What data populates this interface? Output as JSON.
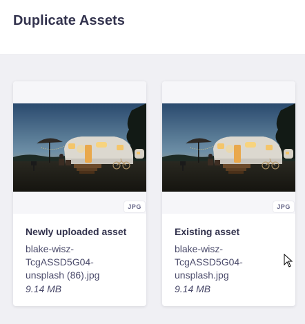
{
  "dialog": {
    "title": "Duplicate Assets"
  },
  "cards": [
    {
      "heading": "Newly uploaded asset",
      "filename": "blake-wisz-TcgASSD5G04-unsplash (86).jpg",
      "filename_lines": [
        "blake-wisz-",
        "TcgASSD5G04-",
        "unsplash (86).jpg"
      ],
      "size": "9.14 MB",
      "format_badge": "JPG"
    },
    {
      "heading": "Existing asset",
      "filename": "blake-wisz-TcgASSD5G04-unsplash.jpg",
      "filename_lines": [
        "blake-wisz-",
        "TcgASSD5G04-",
        "unsplash.jpg"
      ],
      "size": "9.14 MB",
      "format_badge": "JPG"
    }
  ],
  "colors": {
    "page_background": "#f0f0f4",
    "card_background": "#ffffff",
    "text_primary": "#32324d",
    "badge_text": "#666687"
  },
  "icons": {
    "cursor": "mouse-pointer-icon"
  }
}
